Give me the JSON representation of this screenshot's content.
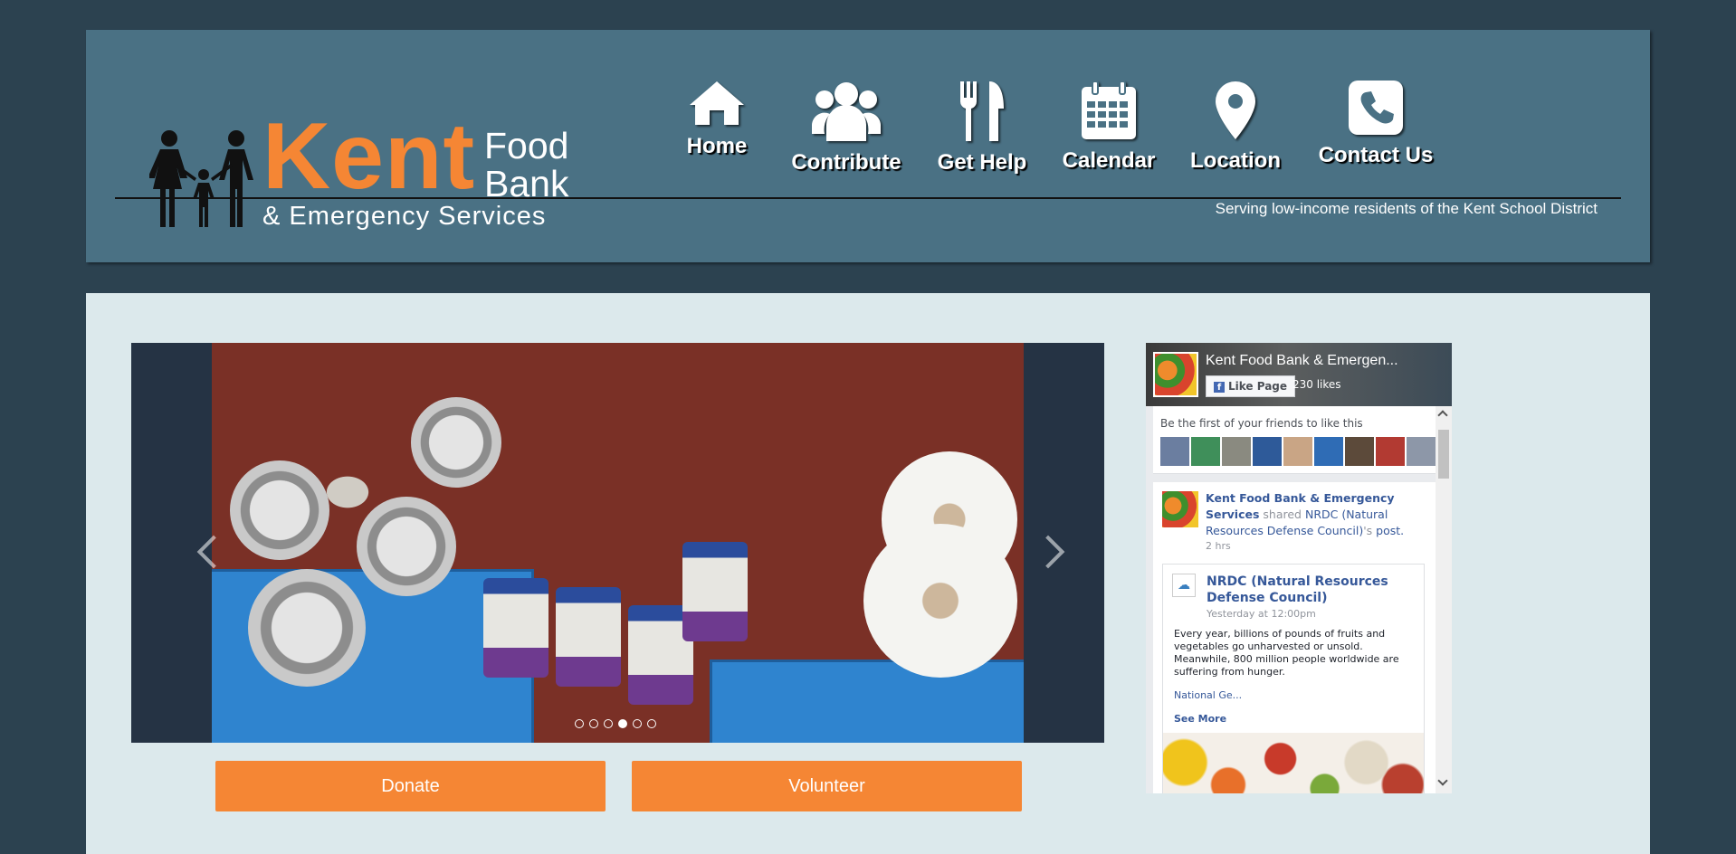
{
  "header": {
    "logo": {
      "kent": "Kent",
      "food": "Food",
      "bank": "Bank",
      "sub": "& Emergency Services"
    },
    "tagline": "Serving low-income residents of the Kent School District",
    "nav": [
      {
        "label": "Home",
        "icon": "home-icon"
      },
      {
        "label": "Contribute",
        "icon": "group-icon"
      },
      {
        "label": "Get Help",
        "icon": "fork-knife-icon"
      },
      {
        "label": "Calendar",
        "icon": "calendar-icon"
      },
      {
        "label": "Location",
        "icon": "map-pin-icon"
      },
      {
        "label": "Contact Us",
        "icon": "phone-icon"
      }
    ]
  },
  "slider": {
    "total_slides": 6,
    "active_slide": 4
  },
  "buttons": {
    "donate": "Donate",
    "volunteer": "Volunteer"
  },
  "facebook": {
    "page_name": "Kent Food Bank & Emergen...",
    "like_button": "Like Page",
    "likes": "230 likes",
    "friends_text": "Be the first of your friends to like this",
    "post": {
      "author": "Kent Food Bank & Emergency Services",
      "action": "shared",
      "link_text": "NRDC (Natural Resources Defense Council)",
      "suffix": "'s",
      "post_word": "post.",
      "time": "2 hrs",
      "shared": {
        "name": "NRDC (Natural Resources Defense Council)",
        "time": "Yesterday at 12:00pm",
        "body": "Every year, billions of pounds of fruits and vegetables go unharvested or unsold. Meanwhile, 800 million people worldwide are suffering from hunger.",
        "more": "National Ge...",
        "see_more": "See More"
      }
    }
  },
  "colors": {
    "background": "#2c4250",
    "header": "#4a7184",
    "accent": "#f58634",
    "content": "#dce9ec"
  }
}
